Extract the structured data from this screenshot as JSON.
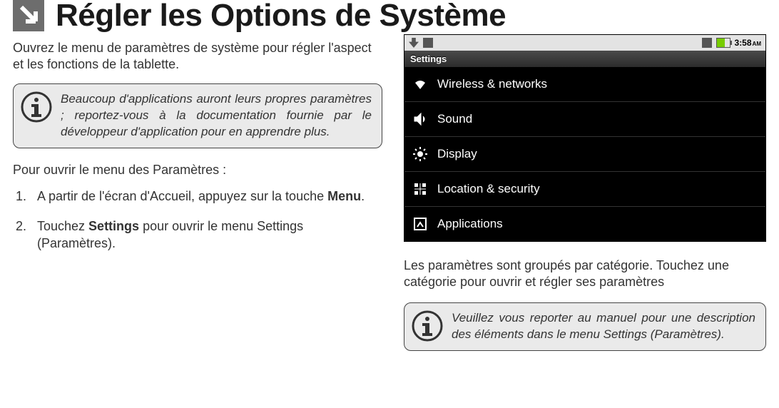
{
  "header": {
    "title": "Régler les Options de Système",
    "intro": "Ouvrez le menu de paramètres de système pour régler l'aspect et les fonctions de la tablette.",
    "info1": "Beaucoup d'applications auront leurs propres paramètres ; reportez-vous à la documentation fournie par le développeur d'application pour en apprendre plus.",
    "subhead": "Pour ouvrir le menu des Paramètres :"
  },
  "steps": [
    {
      "before": "A partir de l'écran d'Accueil, appuyez sur la touche ",
      "bold": "Menu",
      "after": "."
    },
    {
      "before": "Touchez ",
      "bold": "Settings",
      "after": " pour ouvrir le menu Settings (Paramètres)."
    }
  ],
  "tablet": {
    "status": {
      "time": "3:58",
      "ampm": "AM"
    },
    "settings_header": "Settings",
    "items": [
      {
        "icon": "wifi",
        "label": "Wireless & networks"
      },
      {
        "icon": "sound",
        "label": "Sound"
      },
      {
        "icon": "display",
        "label": "Display"
      },
      {
        "icon": "location",
        "label": "Location & security"
      },
      {
        "icon": "apps",
        "label": "Applications"
      }
    ]
  },
  "right": {
    "post": "Les paramètres sont groupés par catégorie. Touchez une catégorie pour ouvrir et régler ses paramètres",
    "info2": "Veuillez vous reporter au manuel pour une description des éléments dans le menu Settings (Paramètres)."
  }
}
